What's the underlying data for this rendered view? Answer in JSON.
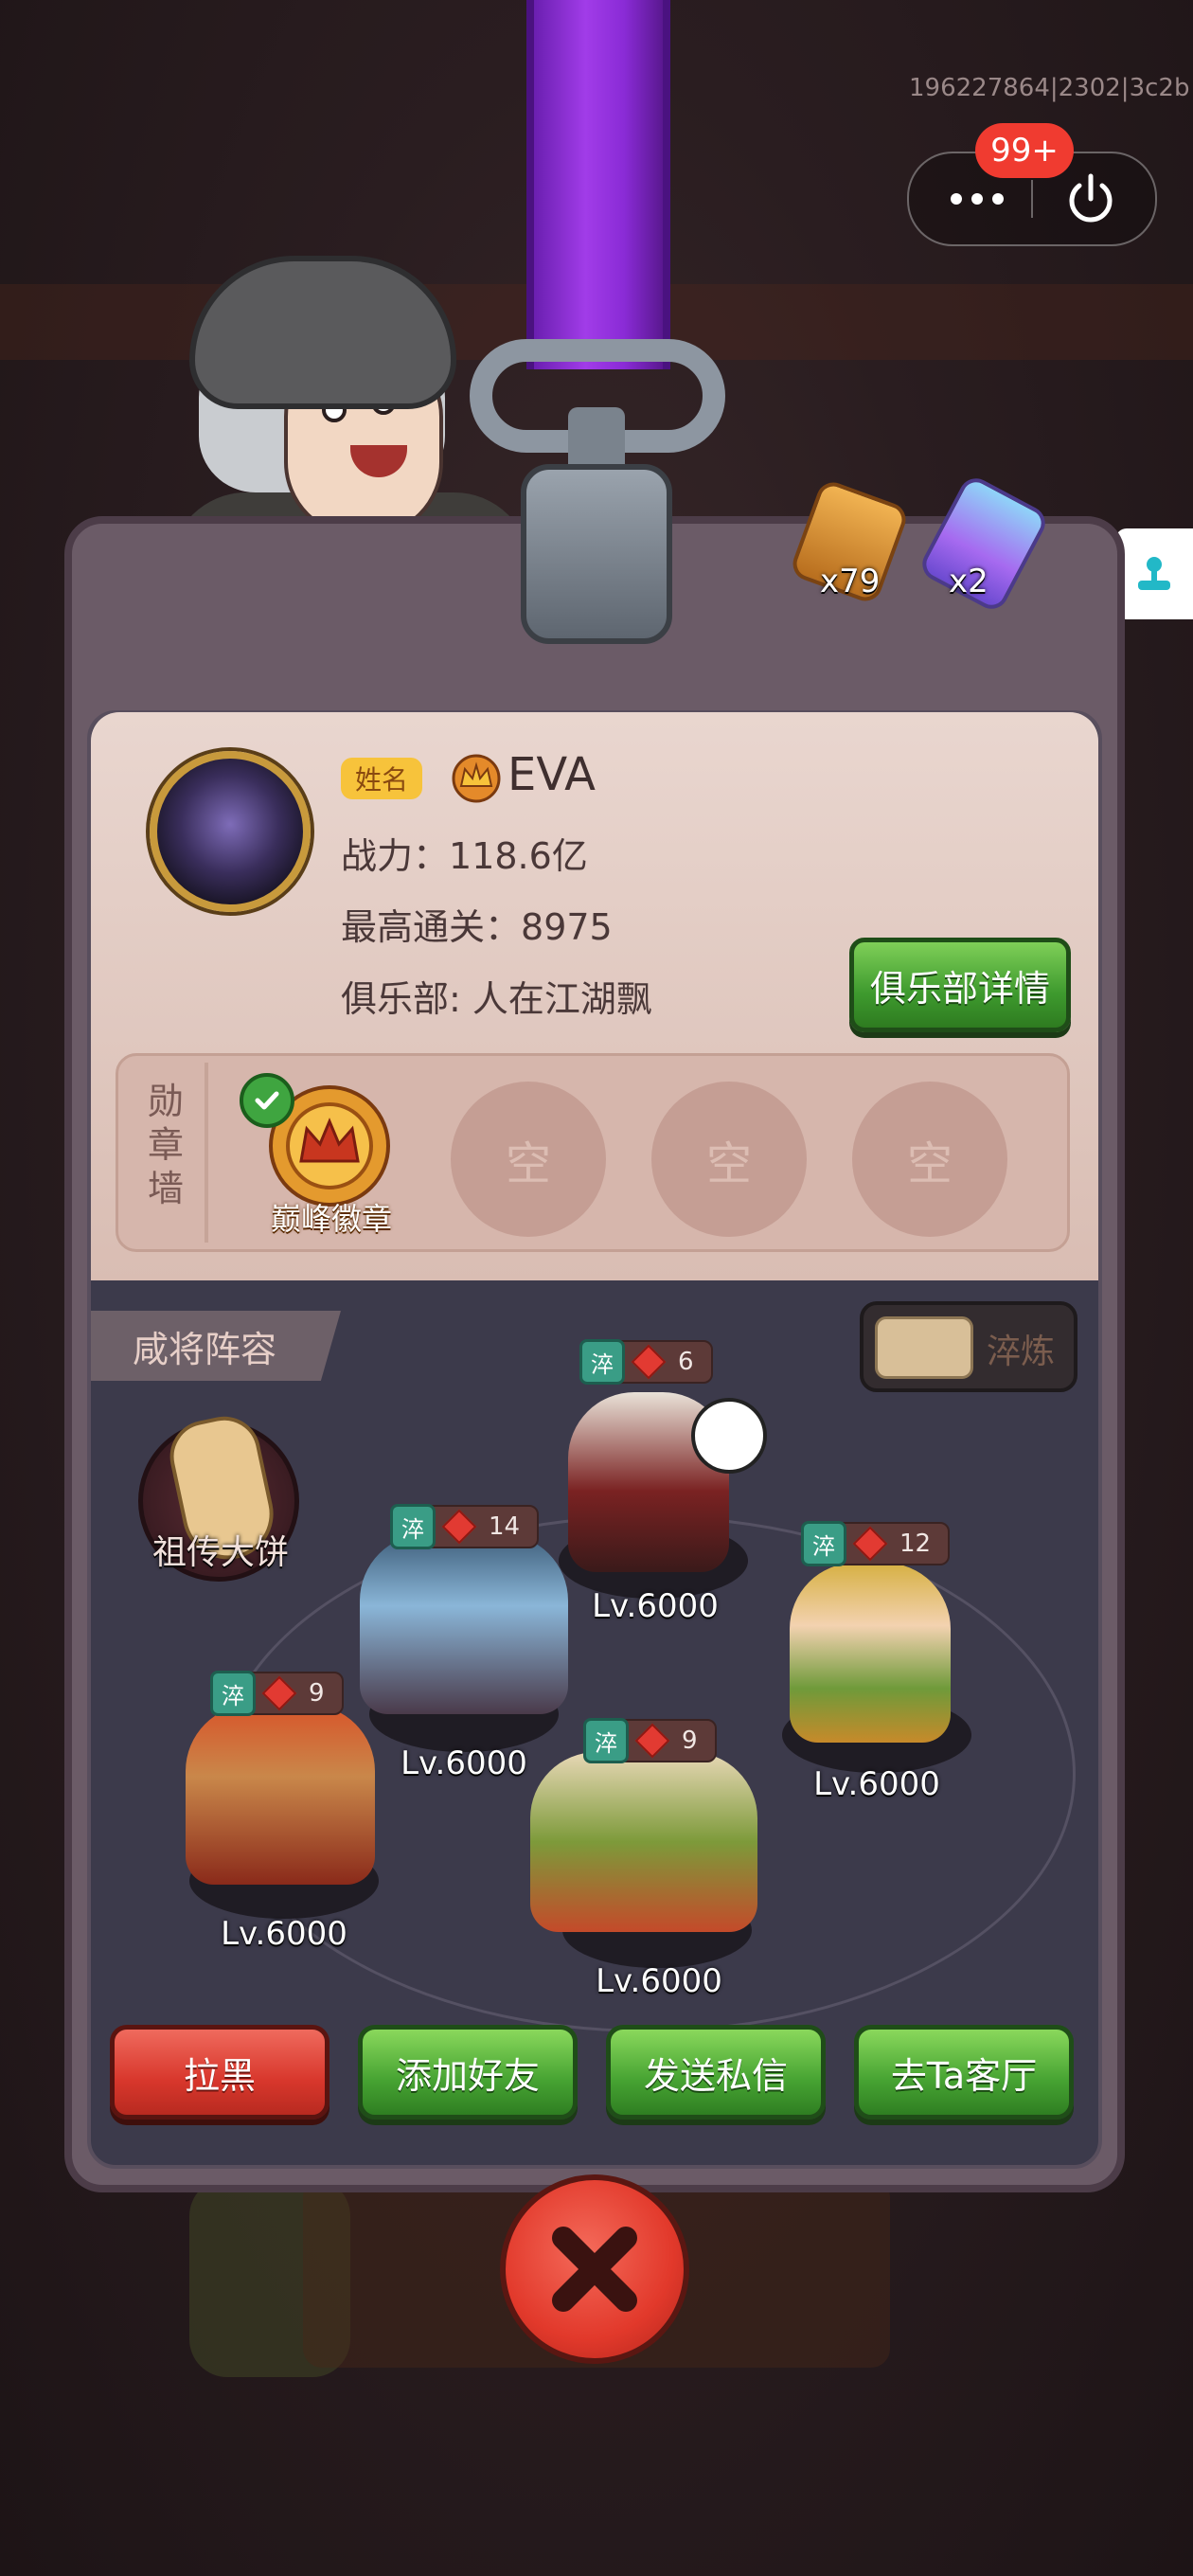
{
  "session_id": "196227864|2302|3c2b",
  "capsule": {
    "badge": "99+"
  },
  "keys": [
    {
      "name": "gold-key",
      "count": "x79",
      "color": "#e3a04a"
    },
    {
      "name": "rainbow-key",
      "count": "x2",
      "color": "#9b6cf0"
    }
  ],
  "profile": {
    "name_tag": "姓名",
    "player_name": "EVA",
    "power_label": "战力：",
    "power_value": "118.6亿",
    "best_clear_label": "最高通关：",
    "best_clear_value": "8975",
    "club_label": "俱乐部:",
    "club_name": "人在江湖飘",
    "club_button": "俱乐部详情"
  },
  "medal_wall": {
    "label": "勋章墙",
    "medals": [
      {
        "label": "巅峰徽章",
        "equipped": true
      },
      {
        "label": "空",
        "equipped": false
      },
      {
        "label": "空",
        "equipped": false
      },
      {
        "label": "空",
        "equipped": false
      }
    ]
  },
  "lineup": {
    "title": "咸将阵容",
    "toggle_label": "淬炼",
    "relic_label": "祖传大饼",
    "heroes": [
      {
        "tag": "淬",
        "stars": "6",
        "level": "Lv.6000"
      },
      {
        "tag": "淬",
        "stars": "14",
        "level": "Lv.6000"
      },
      {
        "tag": "淬",
        "stars": "12",
        "level": "Lv.6000"
      },
      {
        "tag": "淬",
        "stars": "9",
        "level": "Lv.6000"
      },
      {
        "tag": "淬",
        "stars": "9",
        "level": "Lv.6000"
      }
    ]
  },
  "actions": {
    "block": "拉黑",
    "add_friend": "添加好友",
    "send_message": "发送私信",
    "visit_hall": "去Ta客厅"
  },
  "colors": {
    "accent_green": "#46a332",
    "accent_red": "#d8372c",
    "lanyard_purple": "#a13ce8"
  }
}
